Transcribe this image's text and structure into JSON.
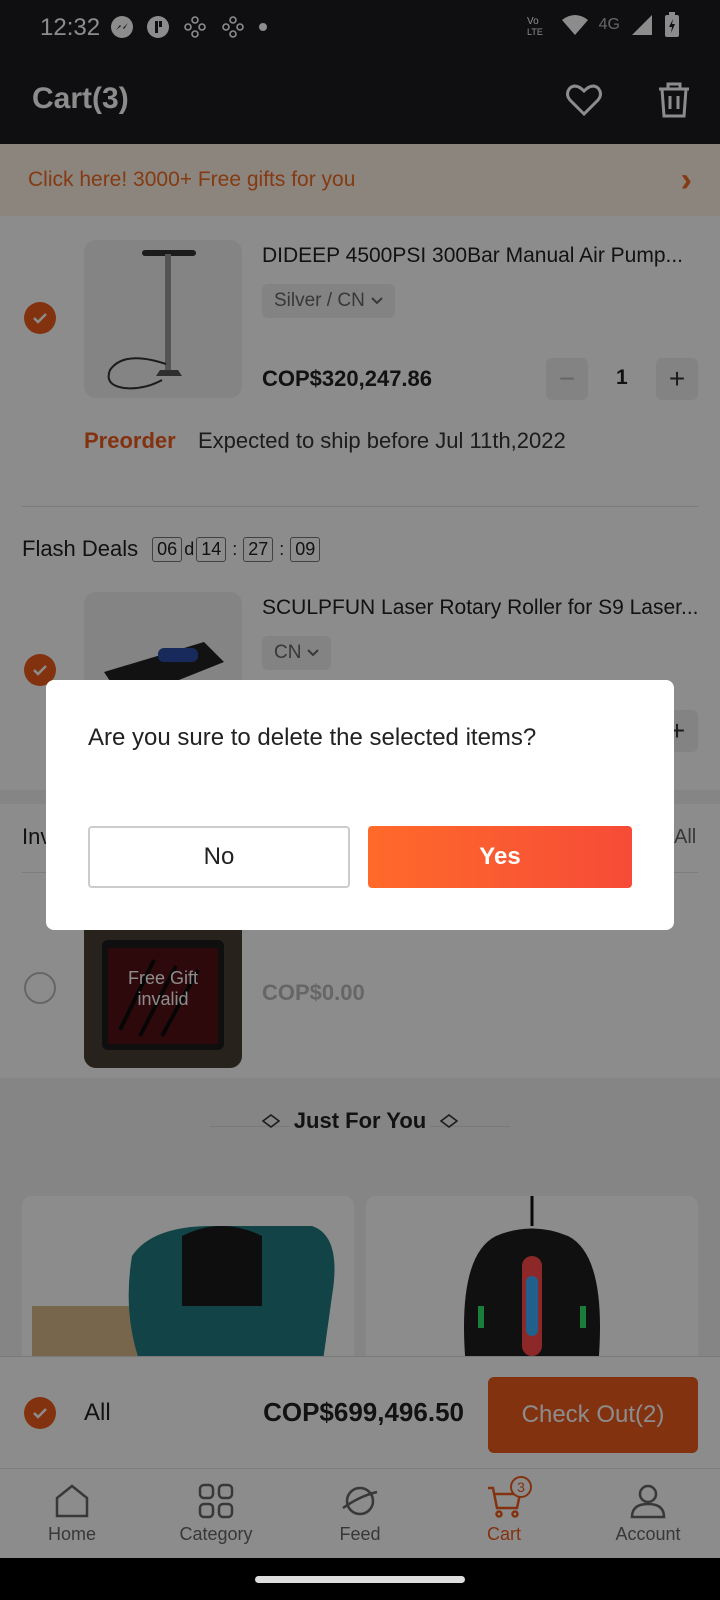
{
  "status_bar": {
    "time": "12:32",
    "network": "4G"
  },
  "header": {
    "title": "Cart(3)"
  },
  "banner": {
    "text": "Click here! 3000+ Free gifts for you",
    "arrow": "›"
  },
  "items": [
    {
      "title": "DIDEEP 4500PSI 300Bar Manual Air Pump...",
      "variant": "Silver / CN",
      "price": "COP$320,247.86",
      "quantity": "1",
      "preorder_label": "Preorder",
      "ship_note": "Expected to ship before Jul 11th,2022"
    },
    {
      "title": "SCULPFUN Laser Rotary Roller for S9 Laser...",
      "variant": "CN"
    }
  ],
  "flash_deals": {
    "label": "Flash Deals",
    "days": "06",
    "d": "d",
    "hours": "14",
    "minutes": "27",
    "seconds": "09"
  },
  "invalid_section": {
    "label_visible": "Inv",
    "clear_all_visible": "All",
    "overlay_text": "Free Gift invalid",
    "price": "COP$0.00"
  },
  "just_for_you": {
    "title": "Just For You"
  },
  "checkout": {
    "all_label": "All",
    "total": "COP$699,496.50",
    "button": "Check Out(2)"
  },
  "nav": {
    "items": [
      {
        "label": "Home",
        "icon": "home-icon"
      },
      {
        "label": "Category",
        "icon": "category-icon"
      },
      {
        "label": "Feed",
        "icon": "feed-icon"
      },
      {
        "label": "Cart",
        "icon": "cart-icon",
        "badge": "3"
      },
      {
        "label": "Account",
        "icon": "account-icon"
      }
    ]
  },
  "dialog": {
    "message": "Are you sure to delete the selected items?",
    "no": "No",
    "yes": "Yes"
  },
  "colors": {
    "accent": "#ee5b1d",
    "dialog_yes_start": "#ff6a2a",
    "dialog_yes_end": "#f64b37"
  }
}
